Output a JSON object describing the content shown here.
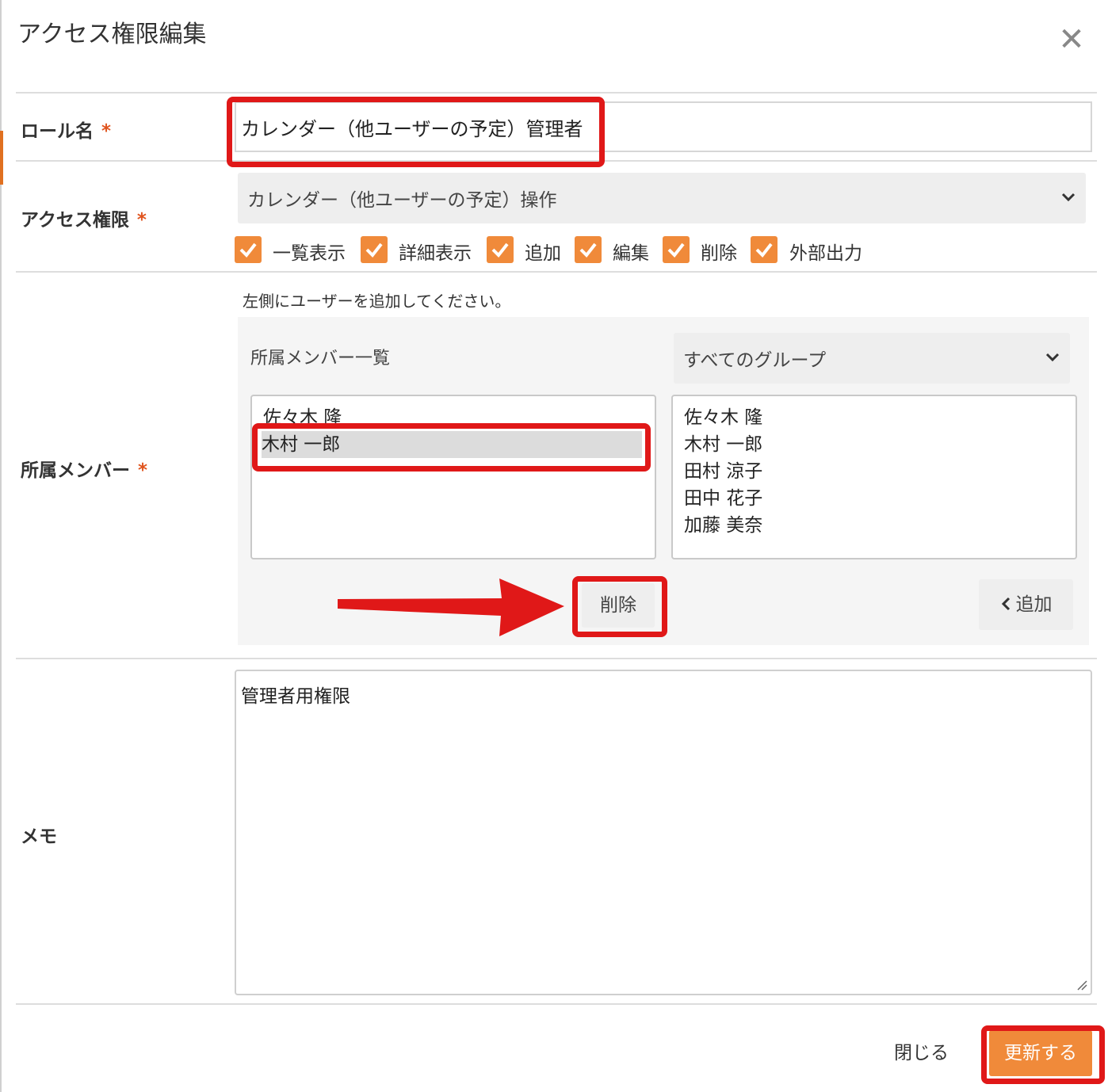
{
  "dialog": {
    "title": "アクセス権限編集",
    "close_icon": "close-icon"
  },
  "role": {
    "label": "ロール名",
    "required_mark": "*",
    "value": "カレンダー（他ユーザーの予定）管理者"
  },
  "access": {
    "label": "アクセス権限",
    "required_mark": "*",
    "selected": "カレンダー（他ユーザーの予定）操作",
    "permissions": [
      {
        "label": "一覧表示",
        "checked": true
      },
      {
        "label": "詳細表示",
        "checked": true
      },
      {
        "label": "追加",
        "checked": true
      },
      {
        "label": "編集",
        "checked": true
      },
      {
        "label": "削除",
        "checked": true
      },
      {
        "label": "外部出力",
        "checked": true
      }
    ]
  },
  "members": {
    "label": "所属メンバー",
    "required_mark": "*",
    "hint": "左側にユーザーを追加してください。",
    "list_title": "所属メンバー一覧",
    "group_select": "すべてのグループ",
    "assigned": [
      "佐々木 隆",
      "木村 一郎"
    ],
    "selected_assigned": "木村 一郎",
    "available": [
      "佐々木 隆",
      "木村 一郎",
      "田村 涼子",
      "田中 花子",
      "加藤 美奈"
    ],
    "delete_label": "削除",
    "add_label": "追加",
    "add_icon": "chevron-left-icon"
  },
  "memo": {
    "label": "メモ",
    "value": "管理者用権限"
  },
  "footer": {
    "close_label": "閉じる",
    "update_label": "更新する"
  },
  "colors": {
    "accent": "#f08a3a",
    "required": "#e0541e",
    "highlight": "#e01818"
  }
}
